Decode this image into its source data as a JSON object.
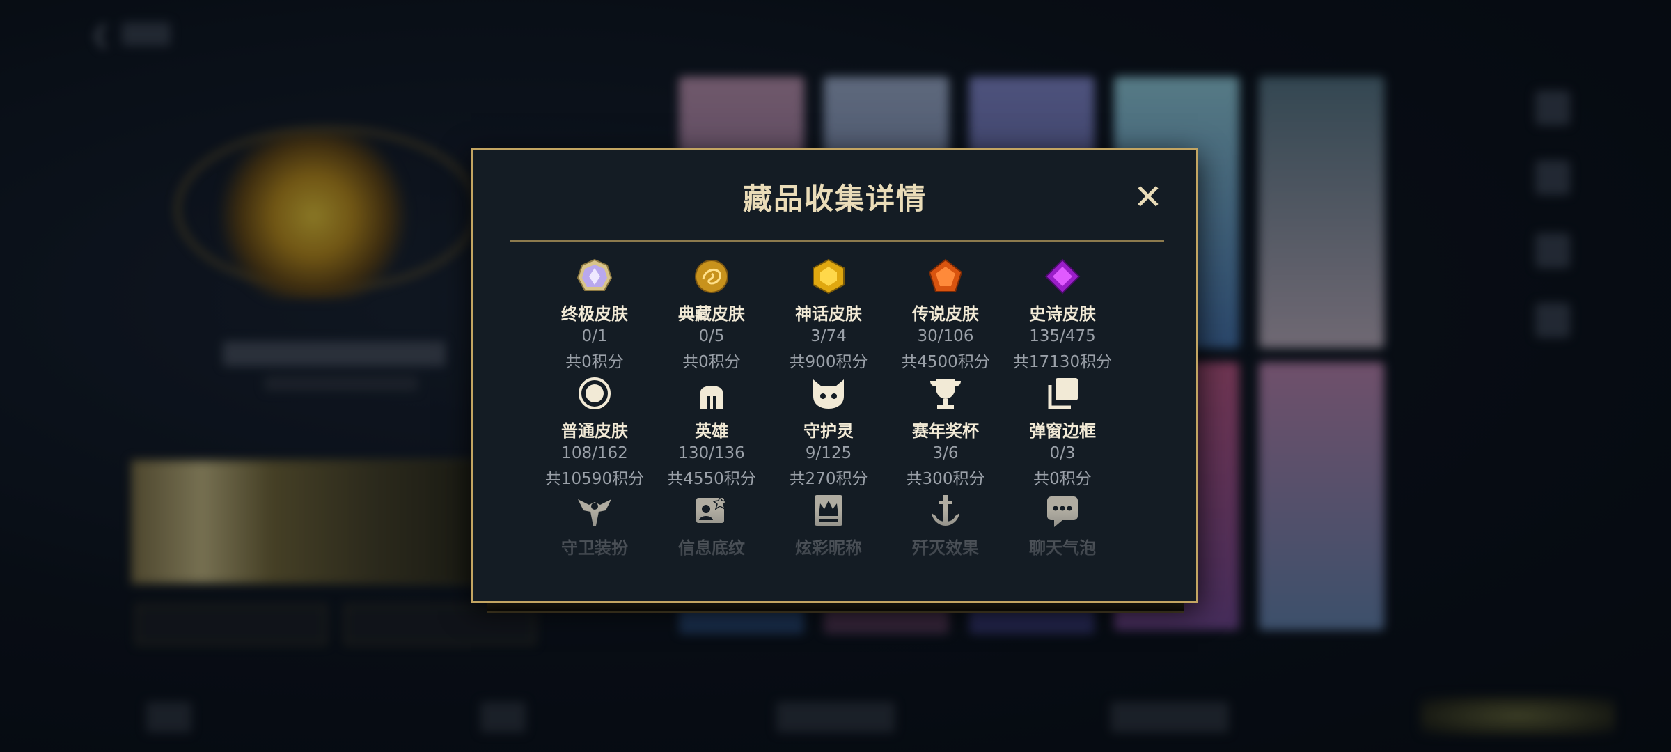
{
  "modal": {
    "title": "藏品收集详情",
    "close_glyph": "✕"
  },
  "categories": [
    {
      "name": "终极皮肤",
      "count": "0/1",
      "points": "共0积分",
      "icon": "ultimate-gem-icon"
    },
    {
      "name": "典藏皮肤",
      "count": "0/5",
      "points": "共0积分",
      "icon": "dragon-emblem-icon"
    },
    {
      "name": "神话皮肤",
      "count": "3/74",
      "points": "共900积分",
      "icon": "gold-gem-icon"
    },
    {
      "name": "传说皮肤",
      "count": "30/106",
      "points": "共4500积分",
      "icon": "orange-gem-icon"
    },
    {
      "name": "史诗皮肤",
      "count": "135/475",
      "points": "共17130积分",
      "icon": "purple-gem-icon"
    },
    {
      "name": "普通皮肤",
      "count": "108/162",
      "points": "共10590积分",
      "icon": "circle-icon"
    },
    {
      "name": "英雄",
      "count": "130/136",
      "points": "共4550积分",
      "icon": "helmet-icon"
    },
    {
      "name": "守护灵",
      "count": "9/125",
      "points": "共270积分",
      "icon": "spirit-icon"
    },
    {
      "name": "赛年奖杯",
      "count": "3/6",
      "points": "共300积分",
      "icon": "trophy-icon"
    },
    {
      "name": "弹窗边框",
      "count": "0/3",
      "points": "共0积分",
      "icon": "frame-icon"
    },
    {
      "name": "守卫装扮",
      "icon": "ward-icon"
    },
    {
      "name": "信息底纹",
      "icon": "card-pattern-icon"
    },
    {
      "name": "炫彩昵称",
      "icon": "crown-name-icon"
    },
    {
      "name": "歼灭效果",
      "icon": "anchor-icon"
    },
    {
      "name": "聊天气泡",
      "icon": "chat-bubble-icon"
    }
  ],
  "colors": {
    "border_gold": "#c3a562",
    "title": "#eadcb8",
    "panel": "#141c24"
  }
}
